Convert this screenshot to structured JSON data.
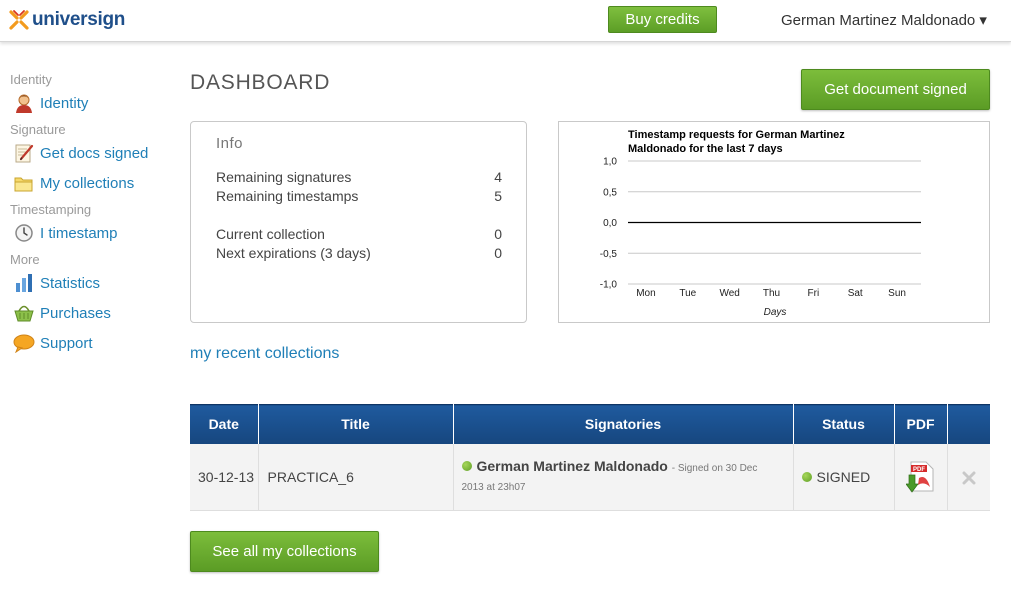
{
  "header": {
    "logo_text": "universign",
    "buy_credits": "Buy credits",
    "user_name": "German Martinez Maldonado ▾"
  },
  "sidebar": {
    "groups": [
      {
        "title": "Identity",
        "items": [
          {
            "label": "Identity",
            "icon": "user-icon"
          }
        ]
      },
      {
        "title": "Signature",
        "items": [
          {
            "label": "Get docs signed",
            "icon": "sign-document-icon"
          },
          {
            "label": "My collections",
            "icon": "folder-icon"
          }
        ]
      },
      {
        "title": "Timestamping",
        "items": [
          {
            "label": "I timestamp",
            "icon": "clock-icon"
          }
        ]
      },
      {
        "title": "More",
        "items": [
          {
            "label": "Statistics",
            "icon": "bar-chart-icon"
          },
          {
            "label": "Purchases",
            "icon": "basket-icon"
          },
          {
            "label": "Support",
            "icon": "speech-bubble-icon"
          }
        ]
      }
    ]
  },
  "main": {
    "title": "DASHBOARD",
    "get_signed": "Get document signed",
    "info": {
      "title": "Info",
      "rows": [
        {
          "label": "Remaining signatures",
          "value": "4"
        },
        {
          "label": "Remaining timestamps",
          "value": "5"
        },
        {
          "label": "Current collection",
          "value": "0"
        },
        {
          "label": "Next expirations (3 days)",
          "value": "0"
        }
      ]
    },
    "recent_link": "my recent collections",
    "table": {
      "headers": [
        "Date",
        "Title",
        "Signatories",
        "Status",
        "PDF",
        ""
      ],
      "rows": [
        {
          "date": "30-12-13",
          "title": "PRACTICA_6",
          "signatory": "German Martinez Maldonado",
          "signed_meta_1": "- Signed on 30 Dec",
          "signed_meta_2": "2013 at 23h07",
          "status": "SIGNED"
        }
      ]
    },
    "see_all": "See all my collections"
  },
  "chart_data": {
    "type": "line",
    "title": "Timestamp requests for German Martinez Maldonado for the last 7 days",
    "title_line1": "Timestamp requests for German Martinez",
    "title_line2": "Maldonado for the last 7 days",
    "categories": [
      "Mon",
      "Tue",
      "Wed",
      "Thu",
      "Fri",
      "Sat",
      "Sun"
    ],
    "series": [
      {
        "values": [
          0,
          0,
          0,
          0,
          0,
          0,
          0
        ]
      }
    ],
    "xlabel": "Days",
    "ylabel": "",
    "ylim": [
      -1.0,
      1.0
    ],
    "yticks": [
      "1,0",
      "0,5",
      "0,0",
      "-0,5",
      "-1,0"
    ],
    "grid": true,
    "colors": {
      "gridline": "#c8c8c8",
      "zeroline": "#000000"
    }
  },
  "colors": {
    "brand_blue": "#1f4f8a",
    "link_blue": "#1f7fb7",
    "button_green": "#6aae30",
    "table_header": "#1a4f8d",
    "status_green": "#7ab83a"
  }
}
